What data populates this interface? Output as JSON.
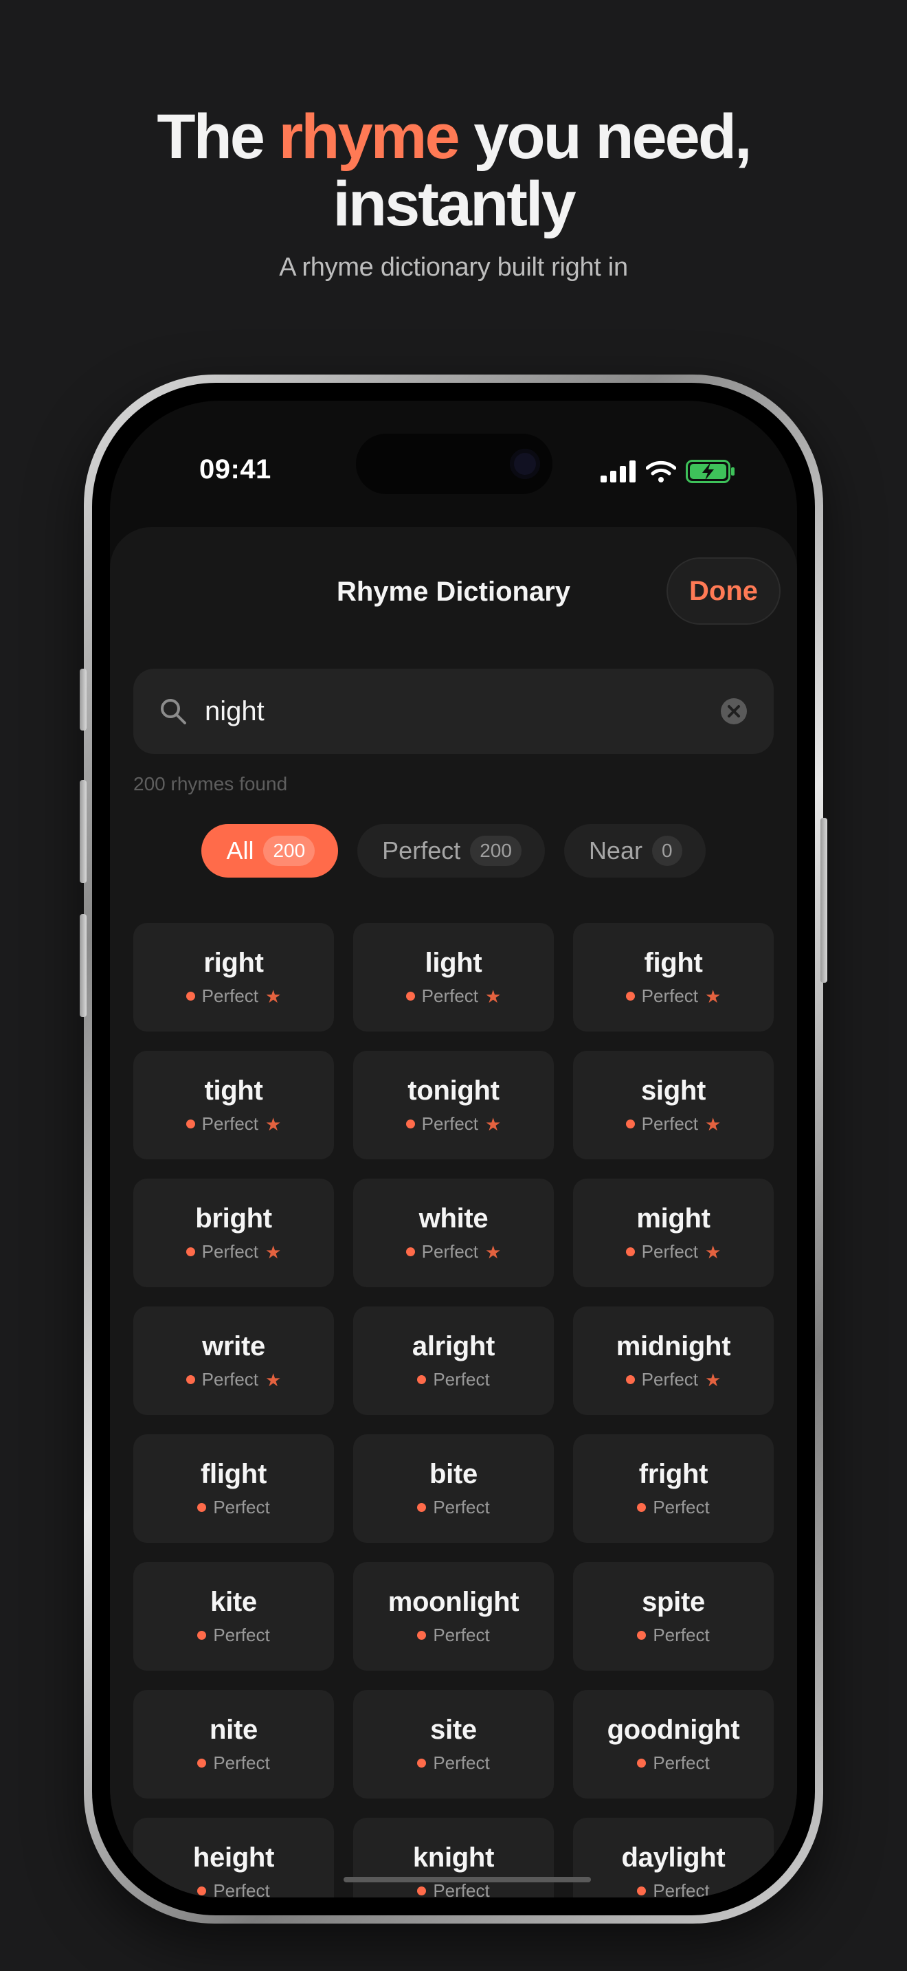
{
  "hero": {
    "title_before": "The ",
    "title_accent": "rhyme",
    "title_after": " you need,",
    "title_line2": "instantly",
    "subtitle": "A rhyme dictionary built right in"
  },
  "status_bar": {
    "time": "09:41"
  },
  "sheet": {
    "title": "Rhyme Dictionary",
    "done_label": "Done"
  },
  "search": {
    "value": "night"
  },
  "results": {
    "count_text": "200 rhymes found"
  },
  "filters": [
    {
      "label": "All",
      "count": "200",
      "active": true
    },
    {
      "label": "Perfect",
      "count": "200",
      "active": false
    },
    {
      "label": "Near",
      "count": "0",
      "active": false
    }
  ],
  "rhymes": [
    {
      "word": "right",
      "type": "Perfect",
      "starred": true
    },
    {
      "word": "light",
      "type": "Perfect",
      "starred": true
    },
    {
      "word": "fight",
      "type": "Perfect",
      "starred": true
    },
    {
      "word": "tight",
      "type": "Perfect",
      "starred": true
    },
    {
      "word": "tonight",
      "type": "Perfect",
      "starred": true
    },
    {
      "word": "sight",
      "type": "Perfect",
      "starred": true
    },
    {
      "word": "bright",
      "type": "Perfect",
      "starred": true
    },
    {
      "word": "white",
      "type": "Perfect",
      "starred": true
    },
    {
      "word": "might",
      "type": "Perfect",
      "starred": true
    },
    {
      "word": "write",
      "type": "Perfect",
      "starred": true
    },
    {
      "word": "alright",
      "type": "Perfect",
      "starred": false
    },
    {
      "word": "midnight",
      "type": "Perfect",
      "starred": true
    },
    {
      "word": "flight",
      "type": "Perfect",
      "starred": false
    },
    {
      "word": "bite",
      "type": "Perfect",
      "starred": false
    },
    {
      "word": "fright",
      "type": "Perfect",
      "starred": false
    },
    {
      "word": "kite",
      "type": "Perfect",
      "starred": false
    },
    {
      "word": "moonlight",
      "type": "Perfect",
      "starred": false
    },
    {
      "word": "spite",
      "type": "Perfect",
      "starred": false
    },
    {
      "word": "nite",
      "type": "Perfect",
      "starred": false
    },
    {
      "word": "site",
      "type": "Perfect",
      "starred": false
    },
    {
      "word": "goodnight",
      "type": "Perfect",
      "starred": false
    },
    {
      "word": "height",
      "type": "Perfect",
      "starred": false
    },
    {
      "word": "knight",
      "type": "Perfect",
      "starred": false
    },
    {
      "word": "daylight",
      "type": "Perfect",
      "starred": false
    }
  ],
  "colors": {
    "accent": "#ff7a55",
    "chip_active": "#ff6b4a",
    "background": "#1b1b1c"
  },
  "icons": {
    "search": "search-icon",
    "clear": "clear-icon",
    "signal": "signal-icon",
    "wifi": "wifi-icon",
    "battery": "battery-charging-icon",
    "star": "star-icon"
  }
}
